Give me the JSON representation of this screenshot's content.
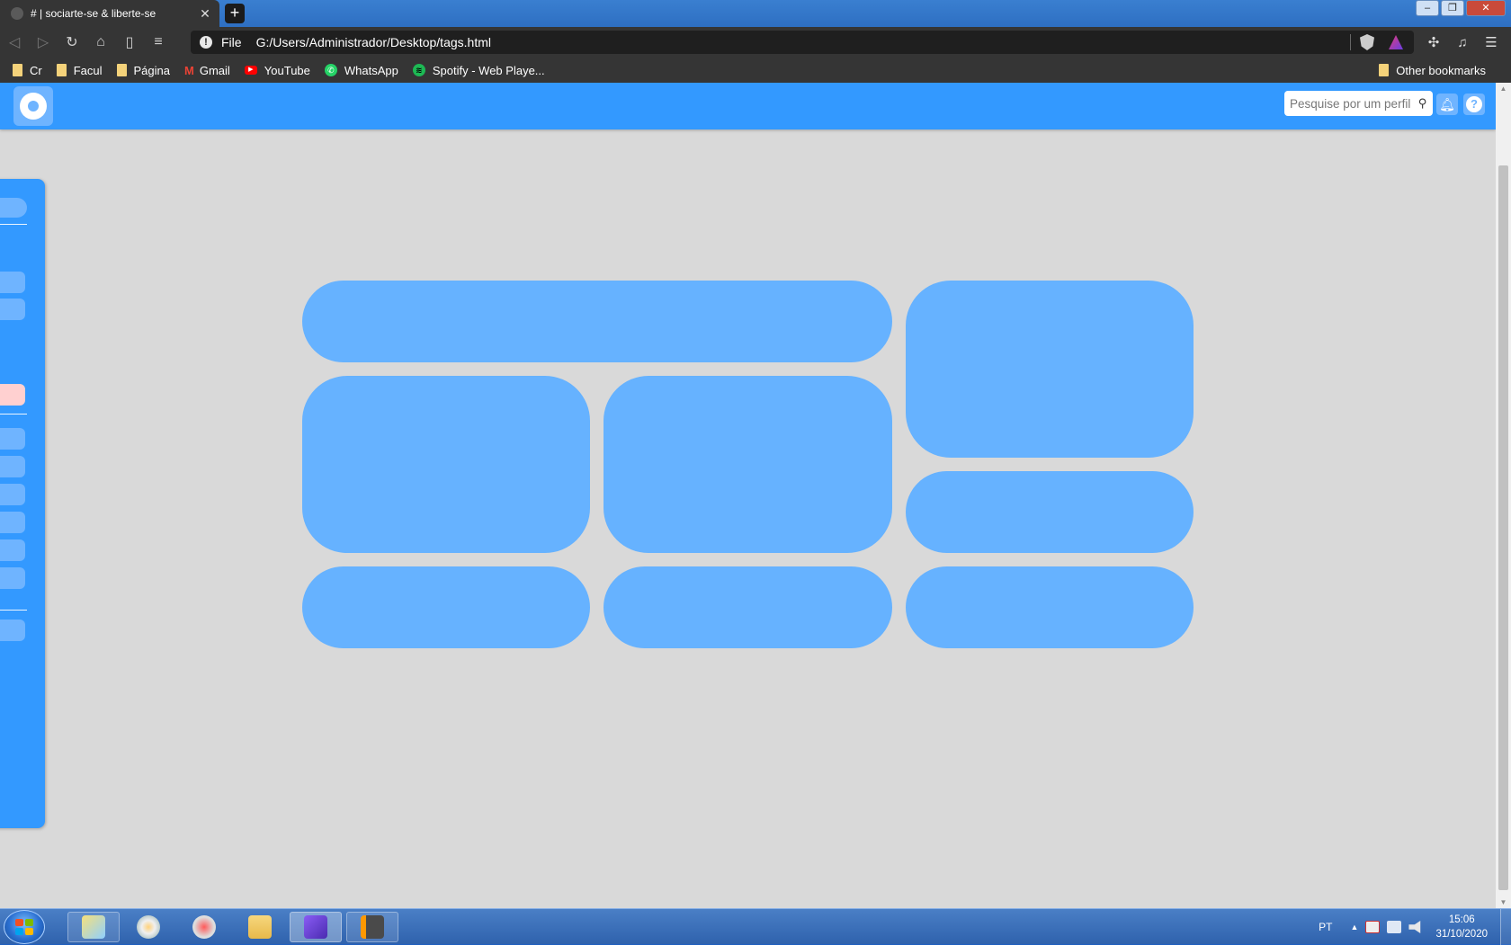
{
  "browser": {
    "tab_title": "# | sociarte-se & liberte-se",
    "new_tab": "+",
    "url_scheme": "File",
    "url": "G:/Users/Administrador/Desktop/tags.html",
    "bookmarks": [
      {
        "label": "Cr",
        "icon": "folder-icon"
      },
      {
        "label": "Facul",
        "icon": "folder-icon"
      },
      {
        "label": "Página",
        "icon": "folder-icon"
      },
      {
        "label": "Gmail",
        "icon": "gmail-icon"
      },
      {
        "label": "YouTube",
        "icon": "youtube-icon"
      },
      {
        "label": "WhatsApp",
        "icon": "whatsapp-icon"
      },
      {
        "label": "Spotify - Web Playe...",
        "icon": "spotify-icon"
      }
    ],
    "other_bookmarks": "Other bookmarks"
  },
  "app": {
    "search_placeholder": "Pesquise por um perfil",
    "accent": "#3399ff",
    "tile_color": "#66b2ff",
    "page_background": "#d9d9d9",
    "alert_item_color": "#ffd0d0"
  },
  "taskbar": {
    "language": "PT",
    "time": "15:06",
    "date": "31/10/2020"
  }
}
